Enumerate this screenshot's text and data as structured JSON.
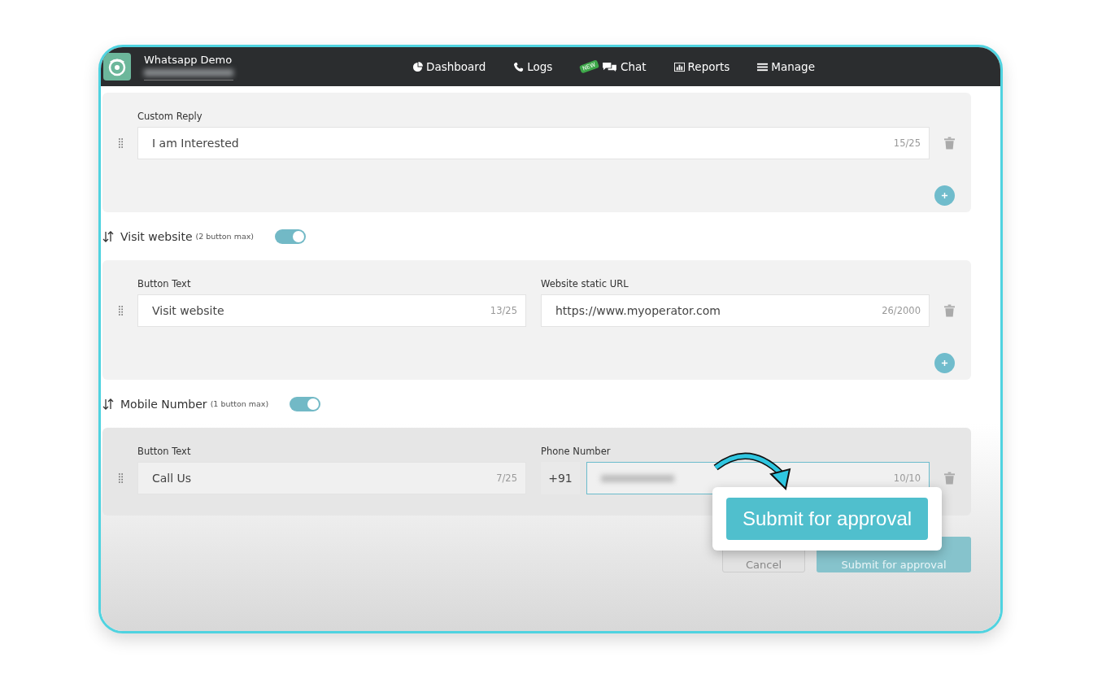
{
  "header": {
    "title": "Whatsapp Demo",
    "nav": [
      {
        "label": "Dashboard"
      },
      {
        "label": "Logs"
      },
      {
        "label": "Chat",
        "badge": "NEW"
      },
      {
        "label": "Reports"
      },
      {
        "label": "Manage"
      }
    ]
  },
  "groups": [
    {
      "add": true,
      "fields": [
        {
          "kind": "text",
          "label": "Custom Reply",
          "value": "I am Interested",
          "counter": "15/25"
        }
      ]
    },
    {
      "title": "Visit website",
      "hint": "(2 button max)",
      "on": true,
      "add": true,
      "fields": [
        {
          "kind": "text",
          "label": "Button Text",
          "value": "Visit website",
          "counter": "13/25"
        },
        {
          "kind": "text",
          "label": "Website static URL",
          "value": "https://www.myoperator.com",
          "counter": "26/2000"
        }
      ]
    },
    {
      "title": "Mobile Number",
      "hint": "(1 button max)",
      "on": true,
      "dim": true,
      "fields": [
        {
          "kind": "text",
          "label": "Button Text",
          "value": "Call Us",
          "counter": "7/25"
        },
        {
          "kind": "phone",
          "label": "Phone Number",
          "prefix": "+91",
          "counter": "10/10"
        }
      ]
    }
  ],
  "actions": [
    {
      "kind": "secondary",
      "label": "Cancel"
    },
    {
      "kind": "primary",
      "label": "Submit for approval"
    }
  ],
  "callout": {
    "label": "Submit for approval"
  }
}
